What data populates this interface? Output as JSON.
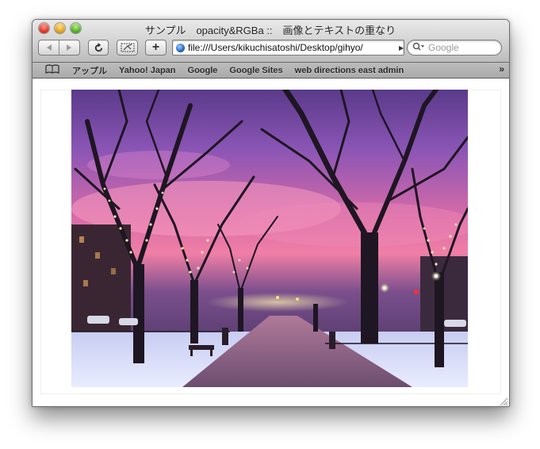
{
  "window": {
    "title": "サンプル　opacity&RGBa ::　画像とテキストの重なり"
  },
  "toolbar": {
    "back_icon": "back-arrow-icon",
    "forward_icon": "forward-arrow-icon",
    "reload_icon": "reload-icon",
    "bug_icon": "snippet-editor-icon",
    "add_icon": "+",
    "url": "file:///Users/kikuchisatoshi/Desktop/gihyo/",
    "search_placeholder": "Google"
  },
  "bookmarks": {
    "items": [
      "アップル",
      "Yahoo! Japan",
      "Google",
      "Google Sites",
      "web directions east admin"
    ],
    "overflow": "»"
  },
  "content": {
    "image_description_icon": "winter-park-twilight-photo"
  },
  "colors": {
    "sky_top": "#5a2f7a",
    "sky_pink": "#e06aa8",
    "snow": "#dfe6ff",
    "path": "#7d5f85"
  }
}
